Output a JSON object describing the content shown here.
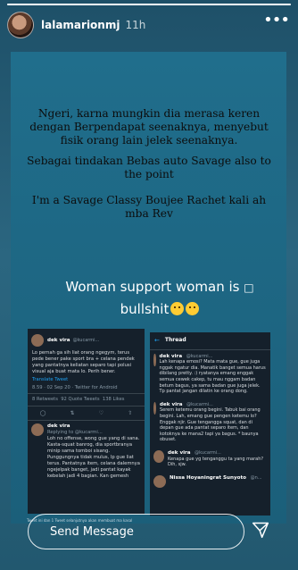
{
  "story": {
    "progress": 1.0,
    "username": "lalamarionmj",
    "time": "11h"
  },
  "caption": {
    "line1": "Ngeri, karna mungkin dia merasa keren dengan Berpendapat seenaknya, menyebut  fisik orang lain jelek seenaknya.",
    "line2": "Sebagai tindakan Bebas auto Savage also to the point",
    "line3": "I'm a Savage Classy Boujee Rachet kali ah mba Rev"
  },
  "headline": {
    "text_line1": "Woman support woman is",
    "text_line2": "bullshit"
  },
  "tweet1": {
    "name": "dek vira",
    "handle": "@kucarmi...",
    "body": "Lo pernah ga sih liat orang ngegym, terus pede bener pake sport bra + celana pendek yang pantatnya keliatan separo tapi polusi visual aja buat mata lo. Perih bener.",
    "translate": "Translate Tweet",
    "meta": "8.59 · 02 Sep 20 · Twitter for Android",
    "retweets": "8 Retweets",
    "quotes": "92 Quote Tweets",
    "likes": "138 Likes",
    "reply_name": "dek vira",
    "reply_to": "Replying to @kucarmi...",
    "reply_body": "Loh no offense, wong gue yang di sana. Kasta-squat banrog, dia sportbranya minip sama tomboi sisang. Punggungnya tidak mulus, lp gue liat terus. Pantatnya item, celana dalemnya ngejelpak banget, jadi pantat kayak kebelah jadi 4 bagian. Kan gemesh"
  },
  "tweet2": {
    "title": "Thread",
    "items": [
      {
        "name": "dek vira",
        "handle": "@kucarmi...",
        "body": "Lah kenapa emosi? Mata mata gue, gue juga nggak ngatur dia. Manatik banget semua harus dibilang pretty. :) ryatanya emang enggak semua cewek cakep, tu mau nggam badan betum bagus, ya sama badan gue juga jelek. Tp pantat jangan dilatin ke orang dong."
      },
      {
        "name": "dek vira",
        "handle": "@kucarmi...",
        "body": "Serem ketemu orang begini. Tabuk bai orang begini. Lah, emang gue pengen ketemu lo? Enggak njir. Gue tengangga squat, dan di depan gue ada pantat separo item, dan kotoknya ke mana2 tapi ya bagus. * baunya obuset."
      },
      {
        "name": "dek vira",
        "handle": "@kucarmi...",
        "body": "Kenapa gue yg tenganggu ta yang marah? Dih, sjw."
      },
      {
        "name": "Nissa Hoyaningrat Sunyoto",
        "handle": "@n...",
        "body": ""
      }
    ]
  },
  "footnote": "Tweet ini dan 1 Tweet selanjutnya akan membuat ma kasal",
  "reply_bar": {
    "placeholder": "Send Message"
  },
  "colors": {
    "background": "#2a5d73",
    "panel": "#1f6a88",
    "tweet_bg": "#15202b",
    "link": "#1da1f2"
  }
}
